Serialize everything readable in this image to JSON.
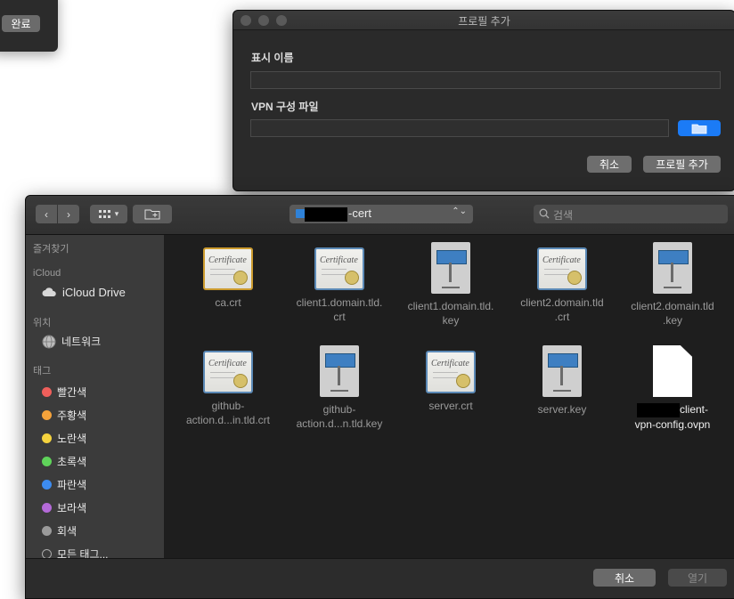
{
  "background_window": {
    "done_label": "완료"
  },
  "dialog": {
    "title": "프로필 추가",
    "display_name_label": "표시 이름",
    "display_name_value": "",
    "vpn_file_label": "VPN 구성 파일",
    "vpn_file_value": "",
    "cancel_label": "취소",
    "add_label": "프로필 추가",
    "accent_color": "#1b7bf6"
  },
  "finder": {
    "path_label": "-cert",
    "search_placeholder": "검색",
    "sidebar": {
      "favorites_header": "즐겨찾기",
      "icloud_header": "iCloud",
      "icloud_drive": "iCloud Drive",
      "locations_header": "위치",
      "network": "네트워크",
      "tags_header": "태그",
      "tags": [
        {
          "label": "빨간색",
          "color": "#ef5f5b"
        },
        {
          "label": "주황색",
          "color": "#f5a33b"
        },
        {
          "label": "노란색",
          "color": "#f5d33e"
        },
        {
          "label": "초록색",
          "color": "#5fd35a"
        },
        {
          "label": "파란색",
          "color": "#3d8cf0"
        },
        {
          "label": "보라색",
          "color": "#b46ad8"
        },
        {
          "label": "회색",
          "color": "#9a9a9a"
        },
        {
          "label": "모든 태그..."
        }
      ]
    },
    "files": [
      {
        "name": "ca.crt",
        "kind": "cert"
      },
      {
        "name": "client1.domain.tld.\ncrt",
        "kind": "cert"
      },
      {
        "name": "client1.domain.tld.\nkey",
        "kind": "key"
      },
      {
        "name": "client2.domain.tld\n.crt",
        "kind": "cert"
      },
      {
        "name": "client2.domain.tld\n.key",
        "kind": "key"
      },
      {
        "name": "github-\naction.d...in.tld.crt",
        "kind": "cert"
      },
      {
        "name": "github-\naction.d...n.tld.key",
        "kind": "key"
      },
      {
        "name": "server.crt",
        "kind": "cert"
      },
      {
        "name": "server.key",
        "kind": "key"
      },
      {
        "name": "client-\nvpn-config.ovpn",
        "kind": "doc"
      }
    ],
    "cancel_label": "취소",
    "open_label": "열기"
  }
}
